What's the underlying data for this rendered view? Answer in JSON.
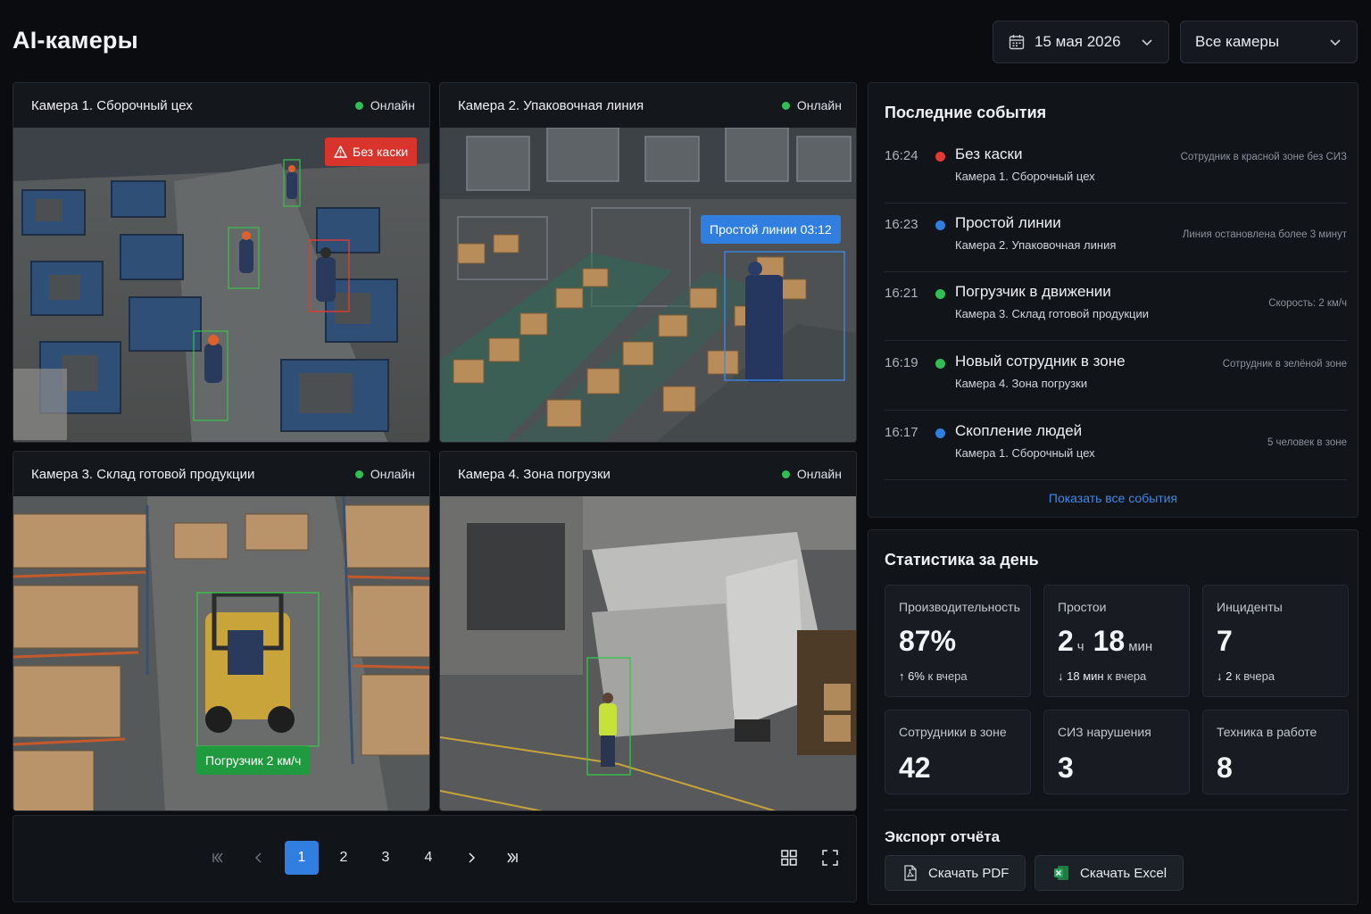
{
  "header": {
    "title": "AI-камеры",
    "date": "15 мая 2026",
    "camera_filter": "Все камеры"
  },
  "cameras": [
    {
      "name": "Камера 1. Сборочный цех",
      "status": "Онлайн",
      "alert": "Без каски",
      "alert_color": "#d9342c"
    },
    {
      "name": "Камера 2. Упаковочная линия",
      "status": "Онлайн",
      "alert": "Простой линии 03:12",
      "alert_color": "#2f7ee0"
    },
    {
      "name": "Камера 3. Склад готовой продукции",
      "status": "Онлайн",
      "alert": "Погрузчик 2 км/ч",
      "alert_color": "#1f9a3e"
    },
    {
      "name": "Камера 4. Зона погрузки",
      "status": "Онлайн",
      "alert": ""
    }
  ],
  "pagination": {
    "pages": [
      "1",
      "2",
      "3",
      "4"
    ],
    "current": "1",
    "icons": [
      "first-page-icon",
      "prev-page-icon",
      "next-page-icon",
      "last-page-icon",
      "grid-view-icon",
      "fullscreen-icon"
    ]
  },
  "events": {
    "title": "Последние события",
    "items": [
      {
        "time": "16:24",
        "title": "Без каски",
        "camera": "Камера 1. Сборочный цех",
        "note": "Сотрудник в красной зоне без СИЗ",
        "color": "#e23a34"
      },
      {
        "time": "16:23",
        "title": "Простой линии",
        "camera": "Камера 2. Упаковочная линия",
        "note": "Линия остановлена более 3 минут",
        "color": "#2f7ee0"
      },
      {
        "time": "16:21",
        "title": "Погрузчик в движении",
        "camera": "Камера 3. Склад готовой продукции",
        "note": "Скорость: 2 км/ч",
        "color": "#2fbf55"
      },
      {
        "time": "16:19",
        "title": "Новый сотрудник в зоне",
        "camera": "Камера 4. Зона погрузки",
        "note": "Сотрудник в зелёной зоне",
        "color": "#2fbf55"
      },
      {
        "time": "16:17",
        "title": "Скопление людей",
        "camera": "Камера 1. Сборочный цех",
        "note": "5 человек в зоне",
        "color": "#2f7ee0"
      }
    ],
    "show_all": "Показать все события"
  },
  "stats": {
    "title": "Статистика за день",
    "cards": [
      {
        "label": "Производительность",
        "value": "87%",
        "delta_arrow": "↑",
        "delta_value": "6%",
        "delta_text": "к вчера"
      },
      {
        "label": "Простои",
        "value_h": "2",
        "unit_h": "ч",
        "value_m": "18",
        "unit_m": "мин",
        "delta_arrow": "↓",
        "delta_value": "18 мин",
        "delta_text": "к вчера"
      },
      {
        "label": "Инциденты",
        "value": "7",
        "delta_arrow": "↓",
        "delta_value": "2",
        "delta_text": "к вчера"
      },
      {
        "label": "Сотрудники в зоне",
        "value": "42"
      },
      {
        "label": "СИЗ нарушения",
        "value": "3"
      },
      {
        "label": "Техника в работе",
        "value": "8"
      }
    ]
  },
  "export": {
    "title": "Экспорт отчёта",
    "pdf": "Скачать PDF",
    "excel": "Скачать Excel"
  },
  "colors": {
    "accent": "#2f7ee0",
    "online": "#2fbf55",
    "danger": "#d9342c",
    "background": "#0a0c10"
  }
}
